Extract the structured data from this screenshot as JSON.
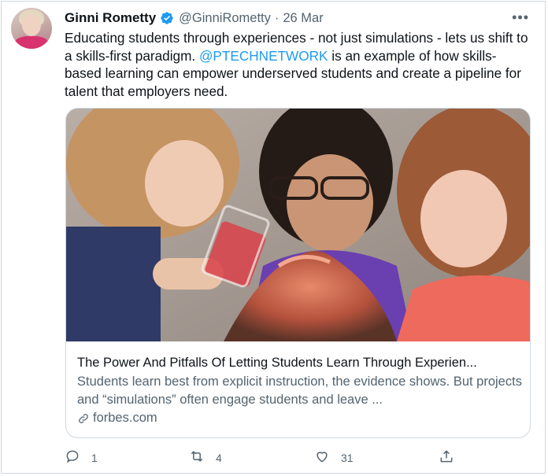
{
  "tweet": {
    "author_name": "Ginni Rometty",
    "handle": "@GinniRometty",
    "separator": "·",
    "date": "26 Mar",
    "more_label": "•••",
    "text_before_mention": "Educating students through experiences - not just simulations - lets us shift to a skills-first paradigm. ",
    "mention": "@PTECHNETWORK",
    "text_after_mention": " is an example of how skills-based learning can empower underserved students and create a pipeline for talent that employers need."
  },
  "card": {
    "title": "The Power And Pitfalls Of Letting Students Learn Through Experien...",
    "description": "Students learn best from explicit instruction, the evidence shows. But projects and “simulations” often engage students and leave ...",
    "domain": "forbes.com"
  },
  "actions": {
    "reply_count": "1",
    "retweet_count": "4",
    "like_count": "31"
  },
  "colors": {
    "accent": "#1d9bf0",
    "text_primary": "#0f1419",
    "text_secondary": "#536471",
    "border": "#cfd9de"
  },
  "icons": {
    "verified": "verified-badge-icon",
    "more": "more-icon",
    "link": "link-icon",
    "reply": "reply-icon",
    "retweet": "retweet-icon",
    "like": "heart-icon",
    "share": "share-icon"
  }
}
